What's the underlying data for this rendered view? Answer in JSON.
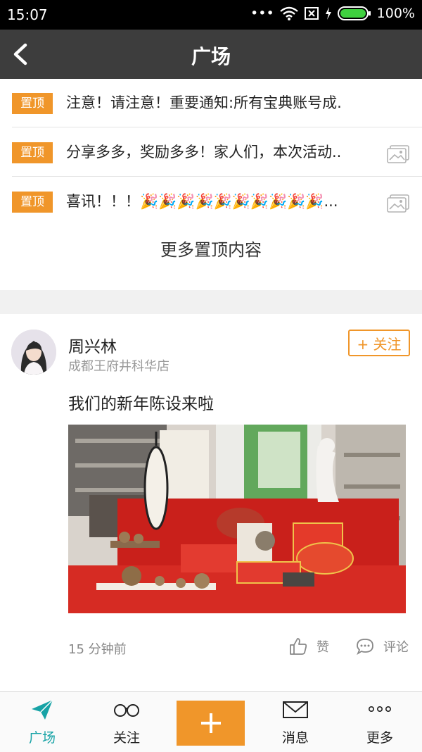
{
  "status": {
    "time": "15:07",
    "battery": "100%",
    "dots": "•••"
  },
  "nav": {
    "title": "广场"
  },
  "pinned": {
    "tag": "置顶",
    "items": [
      {
        "text": "注意！请注意！重要通知:所有宝典账号成.",
        "has_image": false
      },
      {
        "text": "分享多多，奖励多多！家人们，本次活动..",
        "has_image": true
      },
      {
        "text": "喜讯！！！🎉🎉🎉🎉🎉🎉🎉🎉🎉🎉...",
        "has_image": true
      }
    ],
    "more_label": "更多置顶内容"
  },
  "post": {
    "author": "周兴林",
    "location": "成都王府井科华店",
    "follow_label": "+ 关注",
    "content": "我们的新年陈设来啦",
    "time": "15 分钟前",
    "like_label": "赞",
    "comment_label": "评论"
  },
  "tabs": [
    {
      "label": "广场",
      "icon": "paper-plane-icon",
      "active": true
    },
    {
      "label": "关注",
      "icon": "glasses-icon",
      "active": false
    },
    {
      "label": "",
      "icon": "plus-icon",
      "active": false
    },
    {
      "label": "消息",
      "icon": "envelope-icon",
      "active": false
    },
    {
      "label": "更多",
      "icon": "dots-icon",
      "active": false
    }
  ],
  "colors": {
    "accent": "#f0962a",
    "active_tab": "#17a3a6",
    "navbar": "#3d3d3d"
  }
}
